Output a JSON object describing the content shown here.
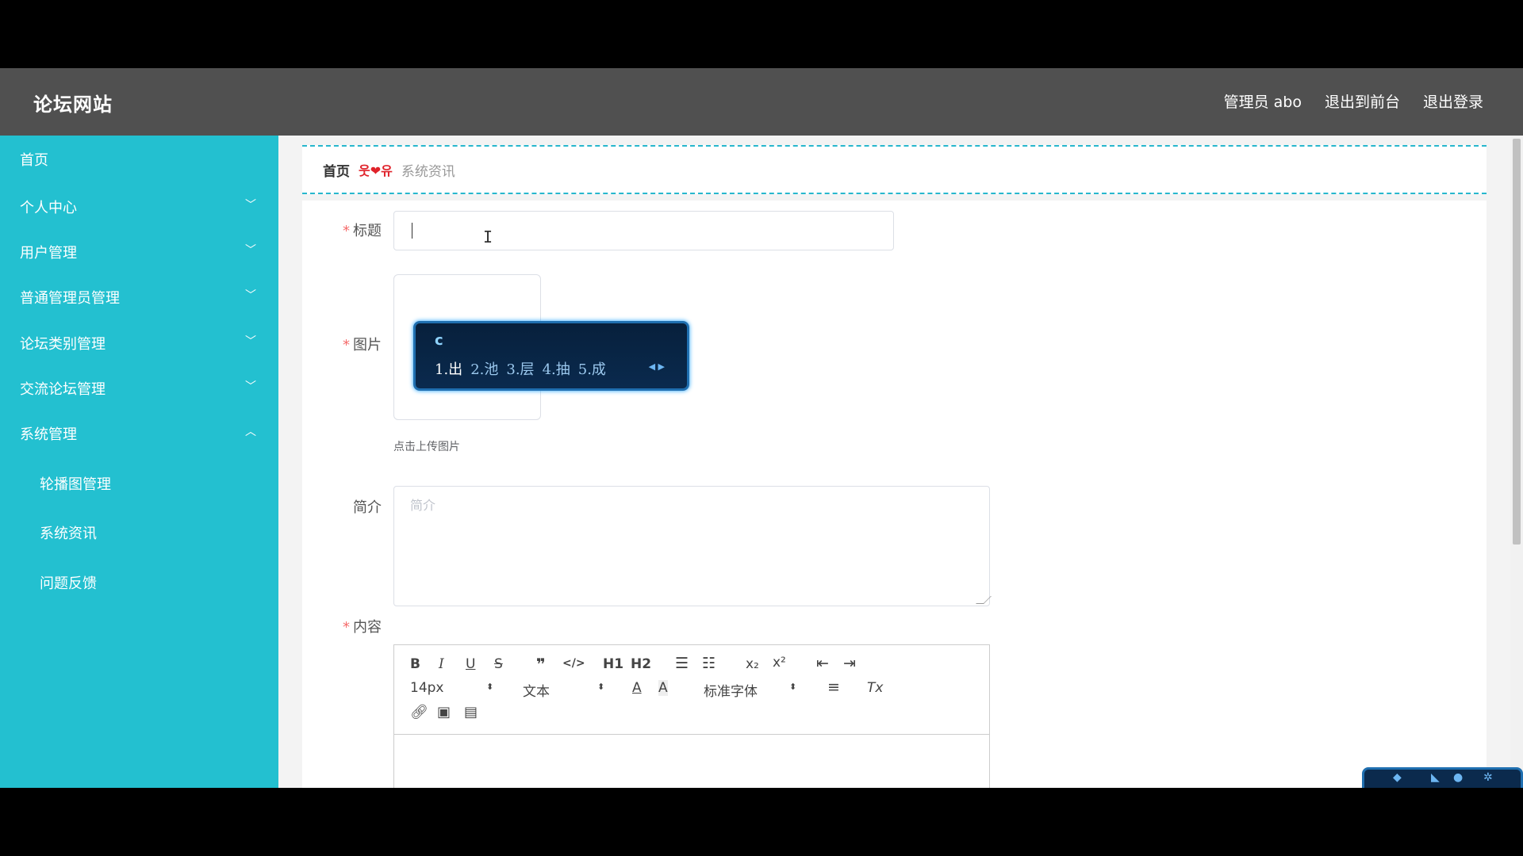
{
  "header": {
    "brand": "论坛网站",
    "admin": "管理员 abo",
    "exit_front": "退出到前台",
    "logout": "退出登录"
  },
  "sidebar": {
    "items": [
      {
        "label": "首页"
      },
      {
        "label": "个人中心"
      },
      {
        "label": "用户管理"
      },
      {
        "label": "普通管理员管理"
      },
      {
        "label": "论坛类别管理"
      },
      {
        "label": "交流论坛管理"
      },
      {
        "label": "系统管理"
      }
    ],
    "sub_items": [
      {
        "label": "轮播图管理"
      },
      {
        "label": "系统资讯"
      },
      {
        "label": "问题反馈"
      }
    ]
  },
  "breadcrumb": {
    "home": "首页",
    "separator": "웃❤유",
    "current": "系统资讯"
  },
  "form": {
    "title_label": "标题",
    "title_value": "",
    "image_label": "图片",
    "upload_tip": "点击上传图片",
    "intro_label": "简介",
    "intro_placeholder": "简介",
    "content_label": "内容",
    "required_mark": "*"
  },
  "editor": {
    "font_size": "14px",
    "block_type": "文本",
    "font_family": "标准字体",
    "bold": "B",
    "italic": "I",
    "underline": "U",
    "strike": "S",
    "quote": "❞",
    "code": "</>",
    "h1": "H1",
    "h2": "H2",
    "sub": "x₂",
    "sup": "x²"
  },
  "ime": {
    "input": "c",
    "candidates": [
      "1.出",
      "2.池",
      "3.层",
      "4.抽",
      "5.成"
    ]
  },
  "colors": {
    "header_bg": "#505050",
    "sidebar_bg": "#23c0d0",
    "accent_dashed": "#27b7cd",
    "required": "#f56c6c"
  }
}
